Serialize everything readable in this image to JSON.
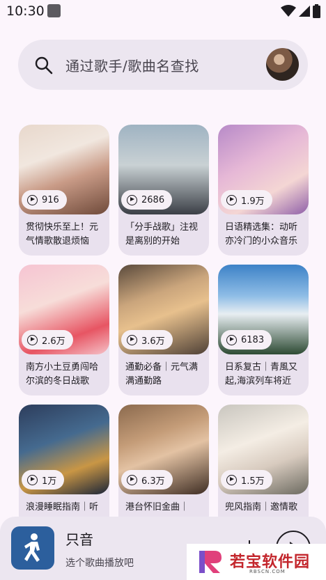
{
  "status_bar": {
    "time": "10:30"
  },
  "search": {
    "placeholder": "通过歌手/歌曲名查找"
  },
  "playlists": [
    {
      "count": "916",
      "title": "贯彻快乐至上！元气情歌散退烦恼"
    },
    {
      "count": "2686",
      "title": "「分手战歌」注视是离别的开始"
    },
    {
      "count": "1.9万",
      "title": "日语精选集：动听亦冷门的小众音乐"
    },
    {
      "count": "2.6万",
      "title": "南方小土豆勇闯哈尔滨的冬日战歌"
    },
    {
      "count": "3.6万",
      "title": "通勤必备｜元气满满通勤路"
    },
    {
      "count": "6183",
      "title": "日系复古｜青風又起,海滨列车将近"
    },
    {
      "count": "1万",
      "title": "浪漫睡眠指南｜听"
    },
    {
      "count": "6.3万",
      "title": "港台怀旧金曲｜"
    },
    {
      "count": "1.5万",
      "title": "兜风指南｜邀情歌"
    }
  ],
  "player": {
    "title": "只音",
    "subtitle": "选个歌曲播放吧"
  },
  "watermark": {
    "brand": "若宝软件园",
    "url": "RBSCN.COM"
  }
}
